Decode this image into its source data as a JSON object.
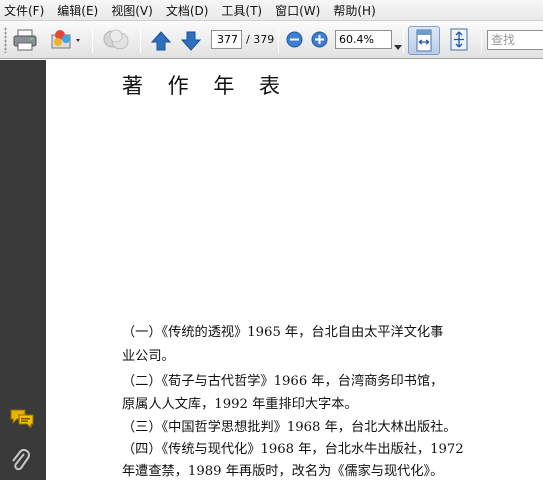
{
  "menu": [
    {
      "label": "文件(F)"
    },
    {
      "label": "编辑(E)"
    },
    {
      "label": "视图(V)"
    },
    {
      "label": "文档(D)"
    },
    {
      "label": "工具(T)"
    },
    {
      "label": "窗口(W)"
    },
    {
      "label": "帮助(H)"
    }
  ],
  "toolbar": {
    "current_page": "377",
    "total_pages": "/ 379",
    "zoom": "60.4%",
    "search_placeholder": "查找"
  },
  "document": {
    "title": "著 作 年 表",
    "lines": [
      "（一）《传统的透视》1965 年，台北自由太平洋文化事",
      "业公司。",
      "（二）《荀子与古代哲学》1966 年，台湾商务印书馆，",
      "原属人人文库，1992 年重排印大字本。",
      "（三）《中国哲学思想批判》1968 年，台北大林出版社。",
      "（四）《传统与现代化》1968 年，台北水牛出版社，1972",
      "年遭查禁，1989 年再版时，改名为《儒家与现代化》。"
    ]
  },
  "colors": {
    "left_panel": "#3a3a3a",
    "nav_arrow": "#2f6fbf",
    "comment_icon": "#e8b400"
  }
}
